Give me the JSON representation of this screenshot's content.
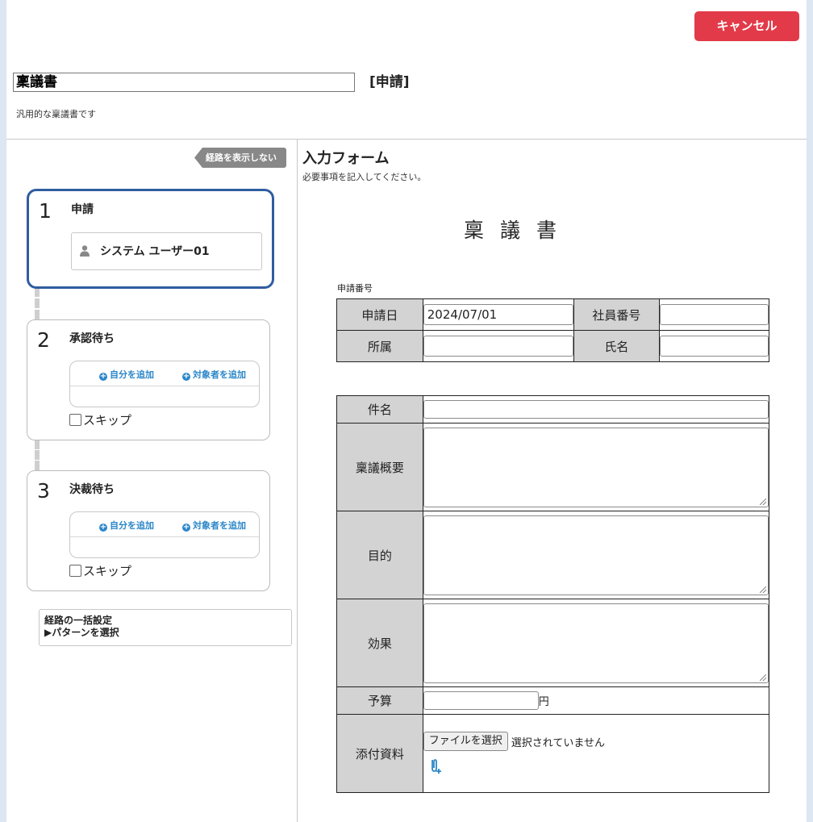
{
  "header": {
    "cancel_label": "キャンセル",
    "title_value": "稟議書",
    "status_label": "[申請]",
    "description": "汎用的な稟議書です"
  },
  "route": {
    "toggle_label": "経路を表示しない",
    "steps": [
      {
        "number": "1",
        "title": "申請",
        "user": "システム ユーザー01"
      },
      {
        "number": "2",
        "title": "承認待ち",
        "add_self": "自分を追加",
        "add_target": "対象者を追加",
        "skip_label": "スキップ"
      },
      {
        "number": "3",
        "title": "決裁待ち",
        "add_self": "自分を追加",
        "add_target": "対象者を追加",
        "skip_label": "スキップ"
      }
    ],
    "bulk_title": "経路の一括設定",
    "bulk_pattern": "▶パターンを選択"
  },
  "form": {
    "heading": "入力フォーム",
    "subheading": "必要事項を記入してください。",
    "doc_title": "稟議書",
    "app_no_label": "申請番号",
    "app_date_label": "申請日",
    "app_date_value": "2024/07/01",
    "employee_no_label": "社員番号",
    "employee_no_value": "",
    "dept_label": "所属",
    "dept_value": "",
    "name_label": "氏名",
    "name_value": "",
    "subject_label": "件名",
    "subject_value": "",
    "summary_label": "稟議概要",
    "purpose_label": "目的",
    "effect_label": "効果",
    "budget_label": "予算",
    "budget_value": "",
    "budget_unit": "円",
    "attach_label": "添付資料",
    "file_button": "ファイルを選択",
    "file_status": "選択されていません"
  },
  "colors": {
    "cancel": "#e23a49",
    "active_step_border": "#2f5da0",
    "link": "#2a86c8",
    "table_head": "#d3d3d3"
  },
  "icons": [
    "person-icon",
    "plus-circle-icon",
    "attach-add-icon"
  ]
}
